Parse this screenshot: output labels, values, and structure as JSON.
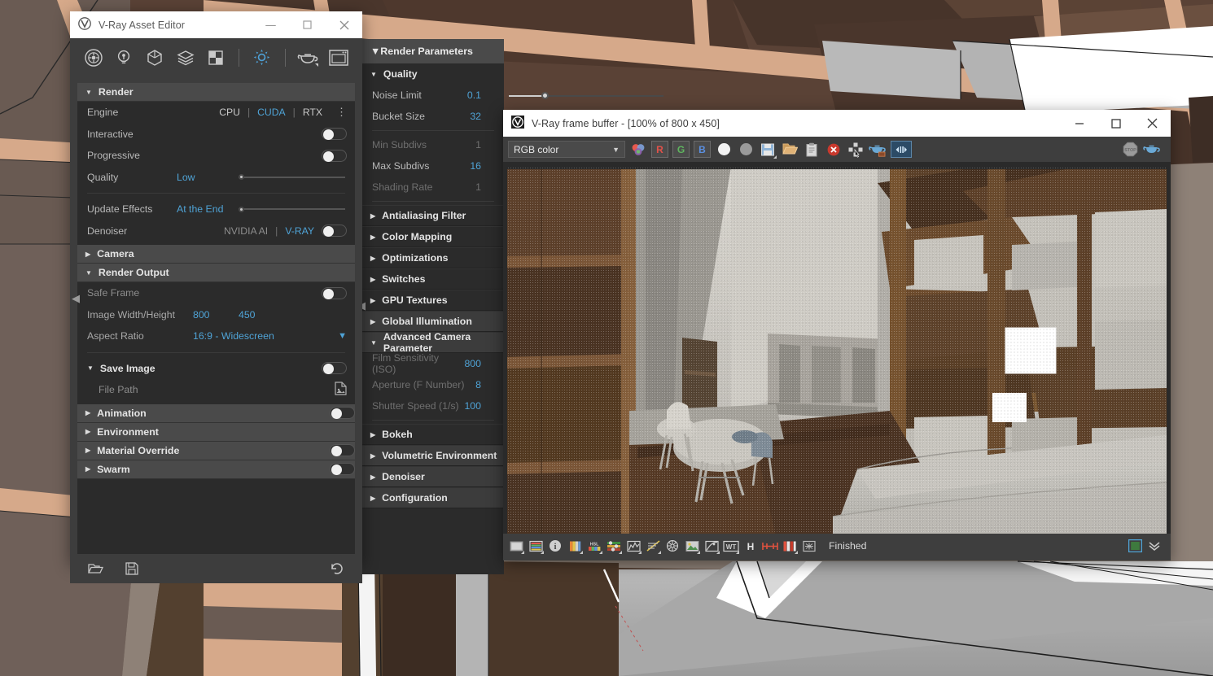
{
  "background": {
    "app": "sketchup-model-viewport"
  },
  "asset_editor": {
    "title": "V-Ray Asset Editor",
    "window_buttons": {
      "minimize": "—",
      "maximize": "☐",
      "close": "✕"
    },
    "toolbar": [
      {
        "name": "materials-icon",
        "label": "Materials"
      },
      {
        "name": "lights-icon",
        "label": "Lights"
      },
      {
        "name": "geometry-icon",
        "label": "Geometry"
      },
      {
        "name": "render-elements-icon",
        "label": "Render Elements"
      },
      {
        "name": "textures-icon",
        "label": "Textures"
      },
      {
        "name": "settings-gear-icon",
        "label": "Settings"
      },
      {
        "name": "render-teapot-icon",
        "label": "Render"
      },
      {
        "name": "frame-buffer-icon",
        "label": "Show Frame Buffer"
      }
    ],
    "sections": {
      "render": {
        "title": "Render",
        "engine": {
          "label": "Engine",
          "options": [
            "CPU",
            "CUDA",
            "RTX"
          ],
          "selected": "CUDA"
        },
        "interactive": {
          "label": "Interactive",
          "value": "off"
        },
        "progressive": {
          "label": "Progressive",
          "value": "off"
        },
        "quality": {
          "label": "Quality",
          "value": "Low"
        },
        "update_effects": {
          "label": "Update Effects",
          "value": "At the End"
        },
        "denoiser": {
          "label": "Denoiser",
          "options": [
            "NVIDIA AI",
            "V-RAY"
          ],
          "selected": "V-RAY",
          "value": "off"
        }
      },
      "camera": {
        "title": "Camera",
        "collapsed": true
      },
      "render_output": {
        "title": "Render Output",
        "safe_frame": {
          "label": "Safe Frame",
          "value": "off"
        },
        "image_size": {
          "label": "Image Width/Height",
          "width": "800",
          "height": "450"
        },
        "aspect_ratio": {
          "label": "Aspect Ratio",
          "value": "16:9 - Widescreen"
        },
        "save_image": {
          "label": "Save Image",
          "value": "off"
        },
        "file_path": {
          "label": "File Path",
          "value": ""
        }
      },
      "animation": {
        "title": "Animation",
        "value": "off"
      },
      "environment": {
        "title": "Environment"
      },
      "material_override": {
        "title": "Material Override",
        "value": "off"
      },
      "swarm": {
        "title": "Swarm",
        "value": "off"
      }
    },
    "footer": {
      "open_icon": "folder-open-icon",
      "save_icon": "floppy-save-icon",
      "revert_icon": "revert-arrow-icon"
    }
  },
  "render_parameters": {
    "title": "Render Parameters",
    "quality": {
      "title": "Quality",
      "rows": [
        {
          "label": "Noise Limit",
          "value": "0.1",
          "dim": false
        },
        {
          "label": "Bucket Size",
          "value": "32",
          "dim": false
        },
        {
          "label": "Min Subdivs",
          "value": "1",
          "dim": true
        },
        {
          "label": "Max Subdivs",
          "value": "16",
          "dim": false
        },
        {
          "label": "Shading Rate",
          "value": "1",
          "dim": true
        }
      ]
    },
    "collapsed_sections_upper": [
      {
        "label": "Antialiasing Filter",
        "highlight": false
      },
      {
        "label": "Color Mapping",
        "highlight": false
      },
      {
        "label": "Optimizations",
        "highlight": false
      },
      {
        "label": "Switches",
        "highlight": false
      },
      {
        "label": "GPU Textures",
        "highlight": false
      },
      {
        "label": "Global Illumination",
        "highlight": true
      }
    ],
    "advanced_camera": {
      "title": "Advanced Camera Parameter",
      "rows": [
        {
          "label": "Film Sensitivity (ISO)",
          "value": "800"
        },
        {
          "label": "Aperture (F Number)",
          "value": "8"
        },
        {
          "label": "Shutter Speed (1/s)",
          "value": "100"
        }
      ]
    },
    "collapsed_sections_lower": [
      {
        "label": "Bokeh",
        "highlight": false
      },
      {
        "label": "Volumetric Environment",
        "highlight": true
      },
      {
        "label": "Denoiser",
        "highlight": true
      },
      {
        "label": "Configuration",
        "highlight": true
      }
    ]
  },
  "frame_buffer": {
    "title": "V-Ray frame buffer - [100% of 800 x 450]",
    "window_buttons": {
      "minimize": "—",
      "maximize": "☐",
      "close": "✕"
    },
    "channel_select": {
      "value": "RGB color",
      "chevron": "∨"
    },
    "toolbar": [
      {
        "name": "color-wheel-icon"
      },
      {
        "name": "red-channel-button",
        "label": "R"
      },
      {
        "name": "green-channel-button",
        "label": "G"
      },
      {
        "name": "blue-channel-button",
        "label": "B"
      },
      {
        "name": "alpha-white-icon"
      },
      {
        "name": "alpha-grey-icon"
      },
      {
        "name": "save-image-icon"
      },
      {
        "name": "load-image-icon"
      },
      {
        "name": "clipboard-copy-icon"
      },
      {
        "name": "clear-image-icon"
      },
      {
        "name": "region-render-icon"
      },
      {
        "name": "render-last-icon"
      },
      {
        "name": "vfb-settings-icon"
      },
      {
        "name": "stop-render-icon"
      },
      {
        "name": "render-teapot-icon"
      }
    ],
    "status_bar": {
      "buttons": [
        {
          "name": "show-image-icon"
        },
        {
          "name": "color-corrections-icon"
        },
        {
          "name": "pixel-info-icon"
        },
        {
          "name": "exposure-icon"
        },
        {
          "name": "hsl-icon"
        },
        {
          "name": "color-balance-icon"
        },
        {
          "name": "levels-icon"
        },
        {
          "name": "curve-icon"
        },
        {
          "name": "lut-icon"
        },
        {
          "name": "background-image-icon"
        },
        {
          "name": "lens-effects-icon"
        },
        {
          "name": "white-balance-icon"
        },
        {
          "name": "hue-icon"
        },
        {
          "name": "compare-horizontal-icon"
        },
        {
          "name": "icc-profile-icon"
        },
        {
          "name": "stamp-icon"
        }
      ],
      "status": "Finished",
      "right_buttons": [
        {
          "name": "render-region-toggle-icon"
        },
        {
          "name": "expand-panel-chevron-icon"
        }
      ]
    },
    "render": {
      "scene": "interior-living-room-with-shelving-unit",
      "size": "800 x 450",
      "zoom": "100%"
    }
  },
  "colors": {
    "accent_blue": "#4fa3d6",
    "panel_dark": "#2b2b2b",
    "panel_mid": "#3d3d3d",
    "header_grey": "#4a4a4a",
    "titlebar_white": "#ffffff"
  }
}
